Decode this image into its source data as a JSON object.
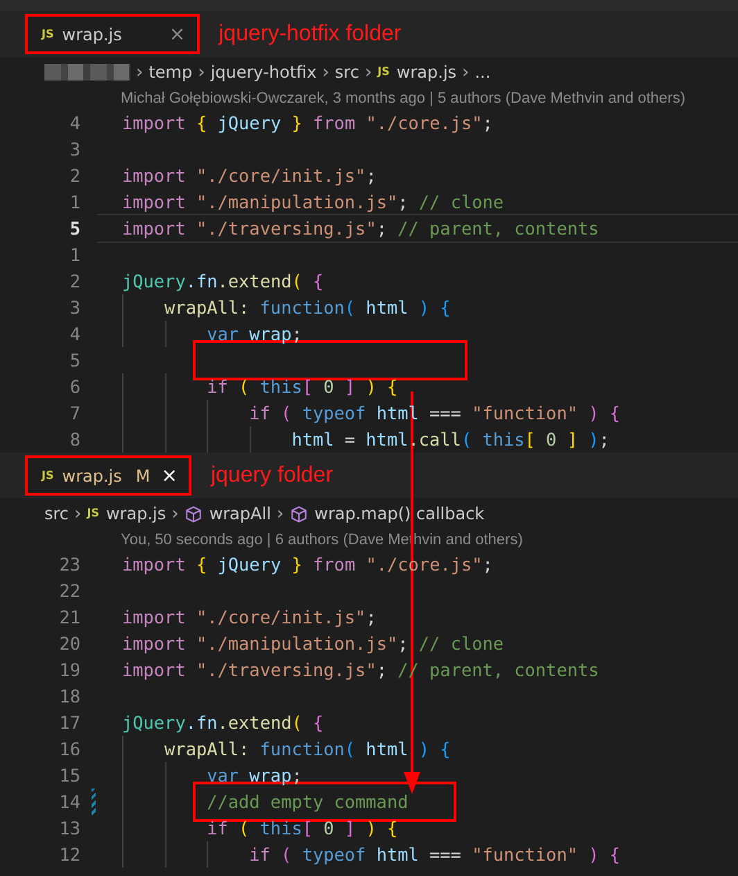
{
  "panes": [
    {
      "tab": {
        "icon": "JS",
        "label": "wrap.js",
        "modified": false,
        "close": "×",
        "outlined": true
      },
      "annotation": "jquery-hotfix folder",
      "separator": "›",
      "breadcrumbs": [
        {
          "kind": "redacted"
        },
        {
          "kind": "folder",
          "text": "temp"
        },
        {
          "kind": "folder",
          "text": "jquery-hotfix"
        },
        {
          "kind": "folder",
          "text": "src"
        },
        {
          "kind": "file",
          "icon": "JS",
          "text": "wrap.js"
        },
        {
          "kind": "more",
          "text": "..."
        }
      ],
      "blame": "Michał Gołębiowski-Owczarek, 3 months ago | 5 authors (Dave Methvin and others)",
      "lines": [
        {
          "number": "4",
          "current": false,
          "changed": false,
          "boxed": false,
          "tokens": [
            {
              "kind": "keyword",
              "text": "import"
            },
            {
              "kind": "b1",
              "text": " {"
            },
            {
              "kind": "variable",
              "text": " jQuery"
            },
            {
              "kind": "b1",
              "text": " }"
            },
            {
              "kind": "keyword",
              "text": " from"
            },
            {
              "kind": "string",
              "text": " \"./core.js\""
            },
            {
              "kind": "plain",
              "text": ";"
            }
          ]
        },
        {
          "number": "3",
          "current": false,
          "changed": false,
          "boxed": false
        },
        {
          "number": "2",
          "current": false,
          "changed": false,
          "boxed": false,
          "tokens": [
            {
              "kind": "keyword",
              "text": "import"
            },
            {
              "kind": "string",
              "text": " \"./core/init.js\""
            },
            {
              "kind": "plain",
              "text": ";"
            }
          ]
        },
        {
          "number": "1",
          "current": false,
          "changed": false,
          "boxed": false,
          "tokens": [
            {
              "kind": "keyword",
              "text": "import"
            },
            {
              "kind": "string",
              "text": " \"./manipulation.js\""
            },
            {
              "kind": "plain",
              "text": ";"
            },
            {
              "kind": "comment",
              "text": " // clone"
            }
          ]
        },
        {
          "number": "5",
          "current": true,
          "changed": false,
          "boxed": false,
          "tokens": [
            {
              "kind": "keyword",
              "text": "import"
            },
            {
              "kind": "string",
              "text": " \"./traversing.js\""
            },
            {
              "kind": "plain",
              "text": ";"
            },
            {
              "kind": "comment",
              "text": " // parent, contents"
            }
          ]
        },
        {
          "number": "1",
          "current": false,
          "changed": false,
          "boxed": false
        },
        {
          "number": "2",
          "current": false,
          "changed": false,
          "boxed": false,
          "tokens": [
            {
              "kind": "class",
              "text": "jQuery"
            },
            {
              "kind": "variable",
              "text": ".fn"
            },
            {
              "kind": "func",
              "text": ".extend"
            },
            {
              "kind": "b1",
              "text": "("
            },
            {
              "kind": "b2",
              "text": " {"
            }
          ]
        },
        {
          "number": "3",
          "current": false,
          "changed": false,
          "boxed": false,
          "tokens": [
            {
              "kind": "func",
              "text": "    wrapAll:"
            },
            {
              "kind": "storage",
              "text": " function"
            },
            {
              "kind": "b3",
              "text": "("
            },
            {
              "kind": "variable",
              "text": " html"
            },
            {
              "kind": "b3",
              "text": " )"
            },
            {
              "kind": "b3",
              "text": " {"
            }
          ]
        },
        {
          "number": "4",
          "current": false,
          "changed": false,
          "boxed": false,
          "tokens": [
            {
              "kind": "storage",
              "text": "        var"
            },
            {
              "kind": "variable",
              "text": " wrap"
            },
            {
              "kind": "plain",
              "text": ";"
            }
          ]
        },
        {
          "number": "5",
          "current": false,
          "changed": false,
          "boxed": true
        },
        {
          "number": "6",
          "current": false,
          "changed": false,
          "boxed": false,
          "tokens": [
            {
              "kind": "keyword",
              "text": "        if"
            },
            {
              "kind": "b1",
              "text": " ("
            },
            {
              "kind": "storage",
              "text": " this"
            },
            {
              "kind": "b2",
              "text": "["
            },
            {
              "kind": "number",
              "text": " 0"
            },
            {
              "kind": "b2",
              "text": " ]"
            },
            {
              "kind": "b1",
              "text": " )"
            },
            {
              "kind": "b1",
              "text": " {"
            }
          ]
        },
        {
          "number": "7",
          "current": false,
          "changed": false,
          "boxed": false,
          "tokens": [
            {
              "kind": "keyword",
              "text": "            if"
            },
            {
              "kind": "b2",
              "text": " ("
            },
            {
              "kind": "storage",
              "text": " typeof"
            },
            {
              "kind": "variable",
              "text": " html"
            },
            {
              "kind": "plain",
              "text": " ==="
            },
            {
              "kind": "string",
              "text": " \"function\""
            },
            {
              "kind": "b2",
              "text": " )"
            },
            {
              "kind": "b2",
              "text": " {"
            }
          ]
        },
        {
          "number": "8",
          "current": false,
          "changed": false,
          "boxed": false,
          "tokens": [
            {
              "kind": "variable",
              "text": "                html"
            },
            {
              "kind": "plain",
              "text": " ="
            },
            {
              "kind": "variable",
              "text": " html"
            },
            {
              "kind": "func",
              "text": ".call"
            },
            {
              "kind": "b3",
              "text": "("
            },
            {
              "kind": "storage",
              "text": " this"
            },
            {
              "kind": "b1",
              "text": "["
            },
            {
              "kind": "number",
              "text": " 0"
            },
            {
              "kind": "b1",
              "text": " ]"
            },
            {
              "kind": "b3",
              "text": " )"
            },
            {
              "kind": "plain",
              "text": ";"
            }
          ]
        }
      ]
    },
    {
      "tab": {
        "icon": "JS",
        "label": "wrap.js",
        "modified": true,
        "badge": "M",
        "close": "×",
        "outlined": true
      },
      "annotation": "jquery folder",
      "separator": "›",
      "breadcrumbs": [
        {
          "kind": "folder",
          "text": "src"
        },
        {
          "kind": "file",
          "icon": "JS",
          "text": "wrap.js"
        },
        {
          "kind": "symbol",
          "text": "wrapAll"
        },
        {
          "kind": "symbol",
          "text": "wrap.map() callback"
        }
      ],
      "blame": "You, 50 seconds ago | 6 authors (Dave Methvin and others)",
      "lines": [
        {
          "number": "23",
          "current": false,
          "changed": false,
          "boxed": false,
          "tokens": [
            {
              "kind": "keyword",
              "text": "import"
            },
            {
              "kind": "b1",
              "text": " {"
            },
            {
              "kind": "variable",
              "text": " jQuery"
            },
            {
              "kind": "b1",
              "text": " }"
            },
            {
              "kind": "keyword",
              "text": " from"
            },
            {
              "kind": "string",
              "text": " \"./core.js\""
            },
            {
              "kind": "plain",
              "text": ";"
            }
          ]
        },
        {
          "number": "22",
          "current": false,
          "changed": false,
          "boxed": false
        },
        {
          "number": "21",
          "current": false,
          "changed": false,
          "boxed": false,
          "tokens": [
            {
              "kind": "keyword",
              "text": "import"
            },
            {
              "kind": "string",
              "text": " \"./core/init.js\""
            },
            {
              "kind": "plain",
              "text": ";"
            }
          ]
        },
        {
          "number": "20",
          "current": false,
          "changed": false,
          "boxed": false,
          "tokens": [
            {
              "kind": "keyword",
              "text": "import"
            },
            {
              "kind": "string",
              "text": " \"./manipulation.js\""
            },
            {
              "kind": "plain",
              "text": ";"
            },
            {
              "kind": "comment",
              "text": " // clone"
            }
          ]
        },
        {
          "number": "19",
          "current": false,
          "changed": false,
          "boxed": false,
          "tokens": [
            {
              "kind": "keyword",
              "text": "import"
            },
            {
              "kind": "string",
              "text": " \"./traversing.js\""
            },
            {
              "kind": "plain",
              "text": ";"
            },
            {
              "kind": "comment",
              "text": " // parent, contents"
            }
          ]
        },
        {
          "number": "18",
          "current": false,
          "changed": false,
          "boxed": false
        },
        {
          "number": "17",
          "current": false,
          "changed": false,
          "boxed": false,
          "tokens": [
            {
              "kind": "class",
              "text": "jQuery"
            },
            {
              "kind": "variable",
              "text": ".fn"
            },
            {
              "kind": "func",
              "text": ".extend"
            },
            {
              "kind": "b1",
              "text": "("
            },
            {
              "kind": "b2",
              "text": " {"
            }
          ]
        },
        {
          "number": "16",
          "current": false,
          "changed": false,
          "boxed": false,
          "tokens": [
            {
              "kind": "func",
              "text": "    wrapAll:"
            },
            {
              "kind": "storage",
              "text": " function"
            },
            {
              "kind": "b3",
              "text": "("
            },
            {
              "kind": "variable",
              "text": " html"
            },
            {
              "kind": "b3",
              "text": " )"
            },
            {
              "kind": "b3",
              "text": " {"
            }
          ]
        },
        {
          "number": "15",
          "current": false,
          "changed": false,
          "boxed": false,
          "tokens": [
            {
              "kind": "storage",
              "text": "        var"
            },
            {
              "kind": "variable",
              "text": " wrap"
            },
            {
              "kind": "plain",
              "text": ";"
            }
          ]
        },
        {
          "number": "14",
          "current": false,
          "changed": true,
          "boxed": true,
          "tokens": [
            {
              "kind": "comment",
              "text": "        //add empty command"
            }
          ]
        },
        {
          "number": "13",
          "current": false,
          "changed": false,
          "boxed": false,
          "tokens": [
            {
              "kind": "keyword",
              "text": "        if"
            },
            {
              "kind": "b1",
              "text": " ("
            },
            {
              "kind": "storage",
              "text": " this"
            },
            {
              "kind": "b2",
              "text": "["
            },
            {
              "kind": "number",
              "text": " 0"
            },
            {
              "kind": "b2",
              "text": " ]"
            },
            {
              "kind": "b1",
              "text": " )"
            },
            {
              "kind": "b1",
              "text": " {"
            }
          ]
        },
        {
          "number": "12",
          "current": false,
          "changed": false,
          "boxed": false,
          "tokens": [
            {
              "kind": "keyword",
              "text": "            if"
            },
            {
              "kind": "b2",
              "text": " ("
            },
            {
              "kind": "storage",
              "text": " typeof"
            },
            {
              "kind": "variable",
              "text": " html"
            },
            {
              "kind": "plain",
              "text": " ==="
            },
            {
              "kind": "string",
              "text": " \"function\""
            },
            {
              "kind": "b2",
              "text": " )"
            },
            {
              "kind": "b2",
              "text": " {"
            }
          ]
        }
      ]
    }
  ]
}
